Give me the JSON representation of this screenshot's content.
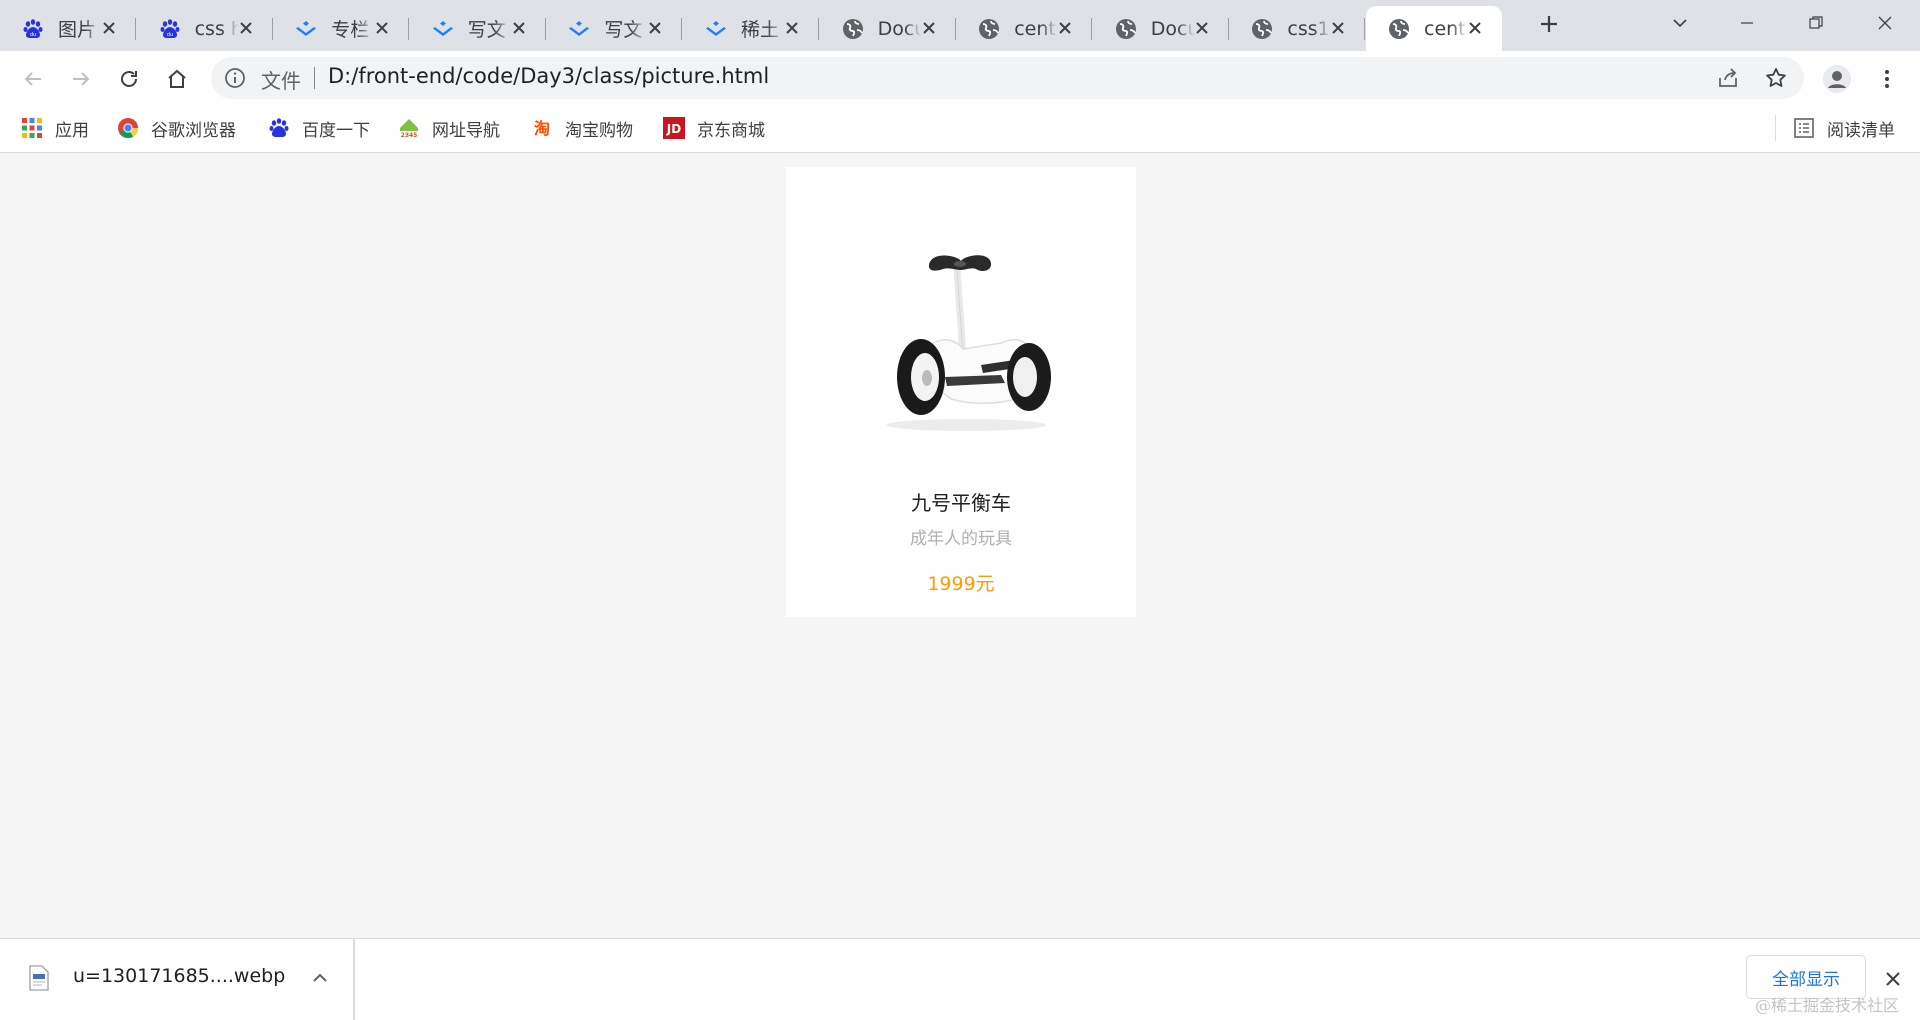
{
  "browser": {
    "tabs": [
      {
        "title": "图片",
        "favicon": "baidu-paw-icon"
      },
      {
        "title": "css h",
        "favicon": "baidu-paw-icon"
      },
      {
        "title": "专栏",
        "favicon": "juejin-icon"
      },
      {
        "title": "写文",
        "favicon": "juejin-icon"
      },
      {
        "title": "写文",
        "favicon": "juejin-icon"
      },
      {
        "title": "稀土",
        "favicon": "juejin-icon"
      },
      {
        "title": "Docu",
        "favicon": "globe-icon"
      },
      {
        "title": "cent",
        "favicon": "globe-icon"
      },
      {
        "title": "Docu",
        "favicon": "globe-icon"
      },
      {
        "title": "css1",
        "favicon": "globe-icon"
      },
      {
        "title": "cent",
        "favicon": "globe-icon",
        "active": true
      }
    ],
    "address_bar": {
      "scheme_label": "文件",
      "url": "D:/front-end/code/Day3/class/picture.html"
    },
    "bookmarks": [
      {
        "label": "应用",
        "icon": "apps-grid-icon"
      },
      {
        "label": "谷歌浏览器",
        "icon": "chrome-icon"
      },
      {
        "label": "百度一下",
        "icon": "baidu-paw-icon"
      },
      {
        "label": "网址导航",
        "icon": "2345-icon"
      },
      {
        "label": "淘宝购物",
        "icon": "taobao-icon"
      },
      {
        "label": "京东商城",
        "icon": "jd-icon"
      }
    ],
    "reading_list_label": "阅读清单"
  },
  "product": {
    "name": "九号平衡车",
    "description": "成年人的玩具",
    "price": "1999元"
  },
  "downloads": {
    "filename": "u=130171685....webp",
    "show_all_label": "全部显示"
  },
  "watermark": "@稀土掘金技术社区",
  "colors": {
    "tabstrip_bg": "#dee1e6",
    "page_bg": "#f5f5f5",
    "price": "#ff9900",
    "description": "#b0b0b0",
    "link_blue": "#1a73e8"
  }
}
